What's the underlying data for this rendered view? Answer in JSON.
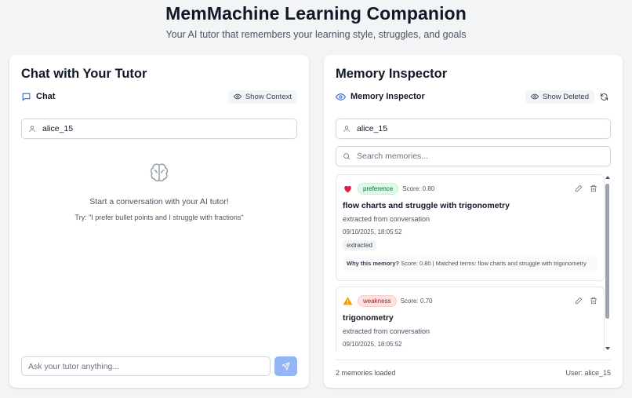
{
  "header": {
    "title": "MemMachine Learning Companion",
    "subtitle": "Your AI tutor that remembers your learning style, struggles, and goals"
  },
  "chat_panel": {
    "title": "Chat with Your Tutor",
    "tab_label": "Chat",
    "show_context_label": "Show Context",
    "user_field_value": "alice_15",
    "empty_main": "Start a conversation with your AI tutor!",
    "empty_hint": "Try: \"I prefer bullet points and I struggle with fractions\"",
    "input_placeholder": "Ask your tutor anything..."
  },
  "memory_panel": {
    "title": "Memory Inspector",
    "tab_label": "Memory Inspector",
    "show_deleted_label": "Show Deleted",
    "user_field_value": "alice_15",
    "search_placeholder": "Search memories...",
    "memories": [
      {
        "type": "preference",
        "type_icon": "heart-icon",
        "score_text": "Score: 0.80",
        "title": "flow charts and struggle with trigonometry",
        "source": "extracted from conversation",
        "timestamp": "09/10/2025, 18:05:52",
        "tag": "extracted",
        "why_label": "Why this memory?",
        "why_text": "Score: 0.80 | Matched terms: flow charts and struggle with trigonometry"
      },
      {
        "type": "weakness",
        "type_icon": "warning-icon",
        "score_text": "Score: 0.70",
        "title": "trigonometry",
        "source": "extracted from conversation",
        "timestamp": "09/10/2025, 18:05:52"
      }
    ],
    "footer_count": "2 memories loaded",
    "footer_user": "User: alice_15"
  },
  "colors": {
    "accent": "#2563eb",
    "send_button": "#93b4f5",
    "preference_badge_bg": "#dcfce7",
    "weakness_badge_bg": "#fee2e2",
    "heart": "#e11d48",
    "warning": "#f59e0b"
  }
}
